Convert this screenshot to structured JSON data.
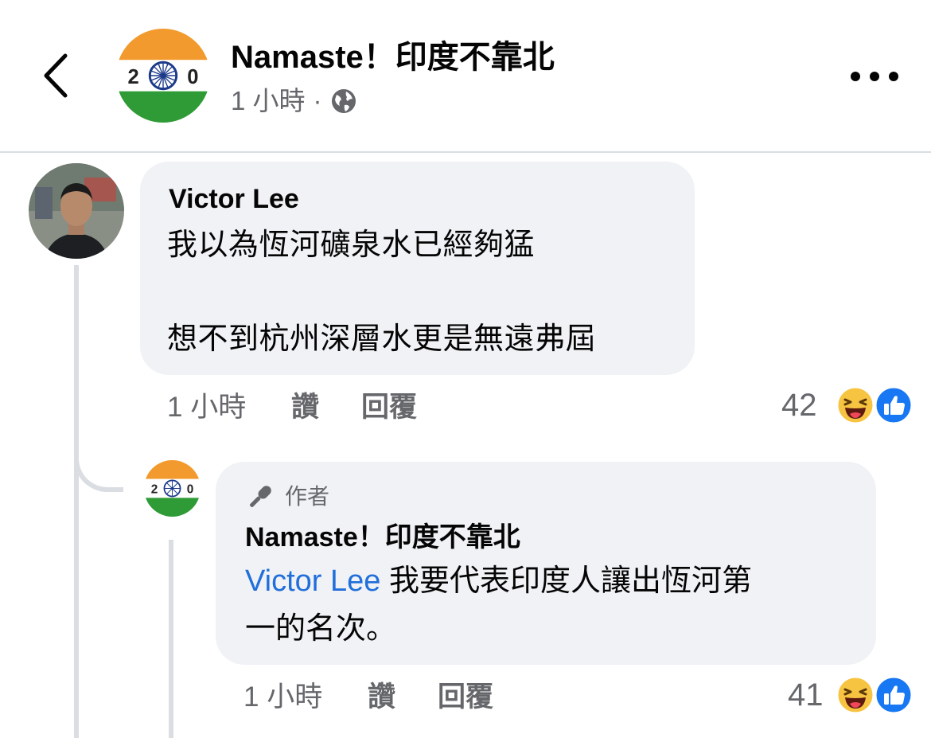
{
  "header": {
    "page_name": "Namaste！印度不靠北",
    "time": "1 小時",
    "separator": "·",
    "avatar_text_left": "2",
    "avatar_text_right": "0",
    "icons": {
      "back": "chevron-left-icon",
      "privacy": "globe-icon",
      "more": "more-horizontal-icon"
    }
  },
  "comments": [
    {
      "author": "Victor Lee",
      "lines": [
        "我以為恆河礦泉水已經夠猛",
        "想不到杭州深層水更是無遠弗屆"
      ],
      "time": "1 小時",
      "like_label": "讚",
      "reply_label": "回覆",
      "reaction_count": "42",
      "reaction_icons": [
        "haha-icon",
        "like-icon"
      ]
    }
  ],
  "reply": {
    "badge": "作者",
    "author": "Namaste！印度不靠北",
    "mention": "Victor Lee",
    "line1_rest": " 我要代表印度人讓出恆河第",
    "line2": "一的名次。",
    "time": "1 小時",
    "like_label": "讚",
    "reply_label": "回覆",
    "reaction_count": "41",
    "reaction_icons": [
      "haha-icon",
      "like-icon"
    ]
  },
  "colors": {
    "bubble": "#f0f2f5",
    "secondary_text": "#65676b",
    "mention": "#216fdb",
    "like_blue": "#1877f2",
    "haha_yellow": "#f7c442",
    "flag_saffron": "#f29a2e",
    "flag_green": "#2f9b36",
    "chakra_navy": "#1b3a8a"
  }
}
